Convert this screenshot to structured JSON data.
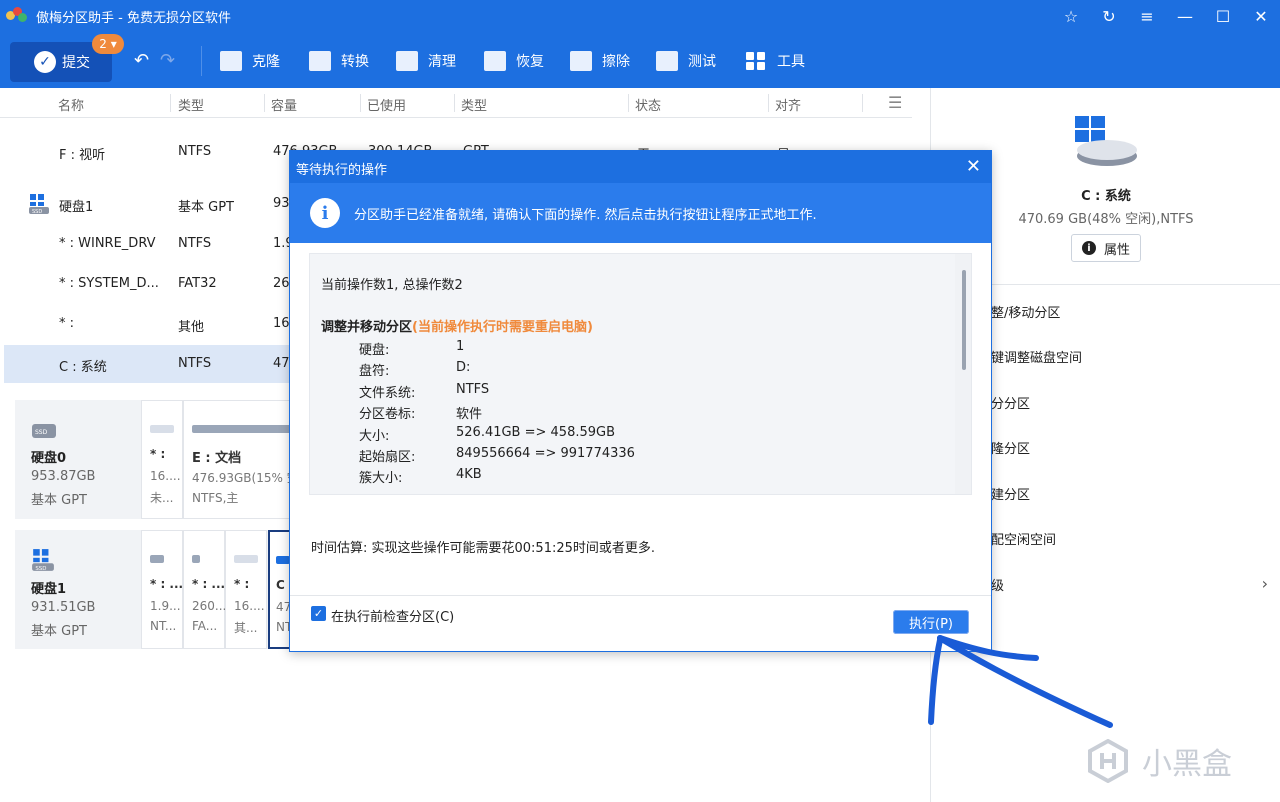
{
  "app": {
    "title": "傲梅分区助手 - 免费无损分区软件"
  },
  "window_controls": [
    "☆",
    "↻",
    "≡",
    "—",
    "☐",
    "✕"
  ],
  "toolbar": {
    "commit_label": "提交",
    "commit_badge": "2",
    "tools": [
      "克隆",
      "转换",
      "清理",
      "恢复",
      "擦除",
      "测试",
      "工具"
    ]
  },
  "table": {
    "headers": [
      "名称",
      "类型",
      "容量",
      "已使用",
      "类型",
      "状态",
      "对齐"
    ],
    "rows": [
      {
        "name": "F : 视听",
        "type": "NTFS",
        "cap": "476.93GB",
        "used": "300.14GB",
        "type2": "GPT",
        "status": "无",
        "align": "是"
      },
      {
        "name": "硬盘1",
        "type": "基本 GPT",
        "cap": "93"
      },
      {
        "name": "* : WINRE_DRV",
        "type": "NTFS",
        "cap": "1.9"
      },
      {
        "name": "* : SYSTEM_D...",
        "type": "FAT32",
        "cap": "26"
      },
      {
        "name": "* :",
        "type": "其他",
        "cap": "16"
      },
      {
        "name": "C : 系统",
        "type": "NTFS",
        "cap": "47"
      }
    ]
  },
  "disk_map": {
    "disk0": {
      "name": "硬盘0",
      "size": "953.87GB",
      "style": "基本 GPT",
      "parts": [
        {
          "l1": "* :",
          "l2": "16....",
          "l3": "未..."
        },
        {
          "l1": "E : 文档",
          "l2": "476.93GB(15% 空",
          "l3": "NTFS,主"
        }
      ]
    },
    "disk1": {
      "name": "硬盘1",
      "size": "931.51GB",
      "style": "基本 GPT",
      "parts": [
        {
          "l1": "* : ...",
          "l2": "1.9...",
          "l3": "NT..."
        },
        {
          "l1": "* : ...",
          "l2": "260....",
          "l3": "FA..."
        },
        {
          "l1": "* :",
          "l2": "16....",
          "l3": "其..."
        },
        {
          "l1": "C",
          "l2": "47",
          "l3": "NT"
        }
      ]
    }
  },
  "right_panel": {
    "name": "C : 系统",
    "info": "470.69 GB(48% 空闲),NTFS",
    "prop_label": "属性",
    "items": [
      "整/移动分区",
      "键调整磁盘空间",
      "分分区",
      "隆分区",
      "建分区",
      "配空闲空间",
      "级"
    ]
  },
  "modal": {
    "title": "等待执行的操作",
    "banner": "分区助手已经准备就绪, 请确认下面的操作. 然后点击执行按钮让程序正式地工作.",
    "op_count": "当前操作数1, 总操作数2",
    "op_heading": "调整并移动分区",
    "op_warn": "(当前操作执行时需要重启电脑)",
    "details": [
      {
        "k": "硬盘:",
        "v": "1"
      },
      {
        "k": "盘符:",
        "v": "D:"
      },
      {
        "k": "文件系统:",
        "v": "NTFS"
      },
      {
        "k": "分区卷标:",
        "v": "软件"
      },
      {
        "k": "大小:",
        "v": "526.41GB => 458.59GB"
      },
      {
        "k": "起始扇区:",
        "v": "849556664 => 991774336"
      },
      {
        "k": "簇大小:",
        "v": "4KB"
      }
    ],
    "estimate": "时间估算: 实现这些操作可能需要花00:51:25时间或者更多.",
    "check_label": "在执行前检查分区(C)",
    "exec_label": "执行(P)"
  },
  "watermark": "小黑盒",
  "colors": {
    "brand": "#1d6fe0",
    "banner": "#2b7cec",
    "warn": "#f08a3c",
    "annotation": "#1a5bd6"
  }
}
